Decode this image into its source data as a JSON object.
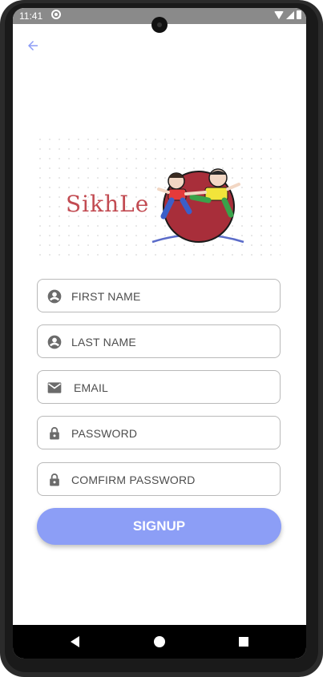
{
  "status_bar": {
    "time": "11:41"
  },
  "logo": {
    "text": "SikhLe"
  },
  "form": {
    "first_name_placeholder": "FIRST NAME",
    "last_name_placeholder": "LAST NAME",
    "email_placeholder": "EMAIL",
    "password_placeholder": "PASSWORD",
    "confirm_password_placeholder": "COMFIRM PASSWORD"
  },
  "signup_button": {
    "label": "SIGNUP"
  },
  "colors": {
    "accent": "#8c9ef6",
    "logo_text": "#c24b52",
    "icon": "#6b6b6b"
  },
  "icons": {
    "back": "arrow-back-icon",
    "first_name": "person-icon",
    "last_name": "person-icon",
    "email": "mail-icon",
    "password": "lock-icon",
    "confirm_password": "lock-icon"
  }
}
